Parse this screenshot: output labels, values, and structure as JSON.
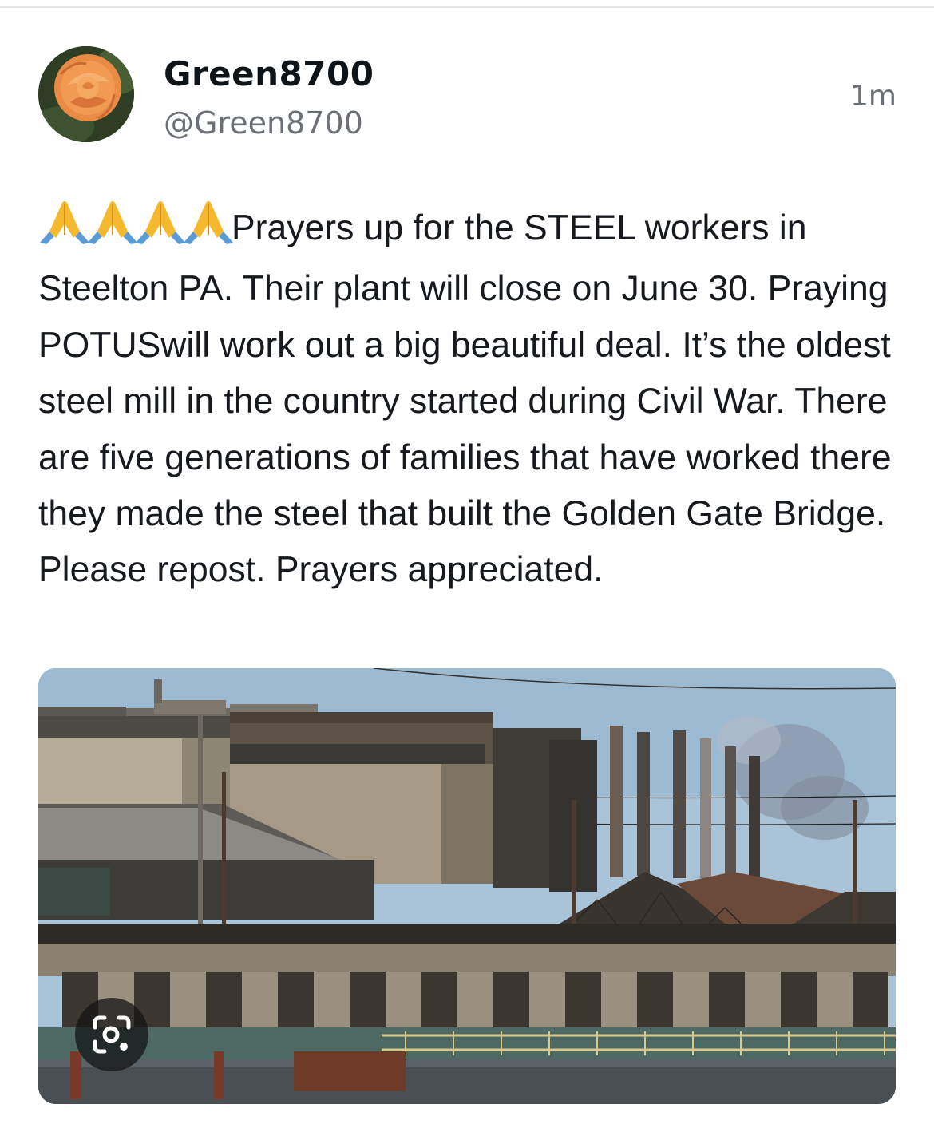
{
  "post": {
    "author": {
      "display_name": "Green8700",
      "handle": "@Green8700",
      "avatar": "orange-rose-avatar"
    },
    "timestamp": "1m",
    "emoji": "🙏🙏🙏🙏",
    "text": "Prayers up for the STEEL workers in Steelton PA. Their plant will close on June 30. Praying POTUSwill work out a big beautiful deal. It’s the oldest steel mill in the country started during Civil War. There are five generations of families that have worked there they made the steel that built the Golden Gate Bridge. Please repost. Prayers appreciated.",
    "media": {
      "type": "photo",
      "subject": "steel mill with smokestacks",
      "overlay_icon": "visual-search-icon"
    }
  },
  "colors": {
    "text_primary": "#0f1419",
    "text_secondary": "#6b6f76",
    "divider": "#e6e6ea"
  }
}
